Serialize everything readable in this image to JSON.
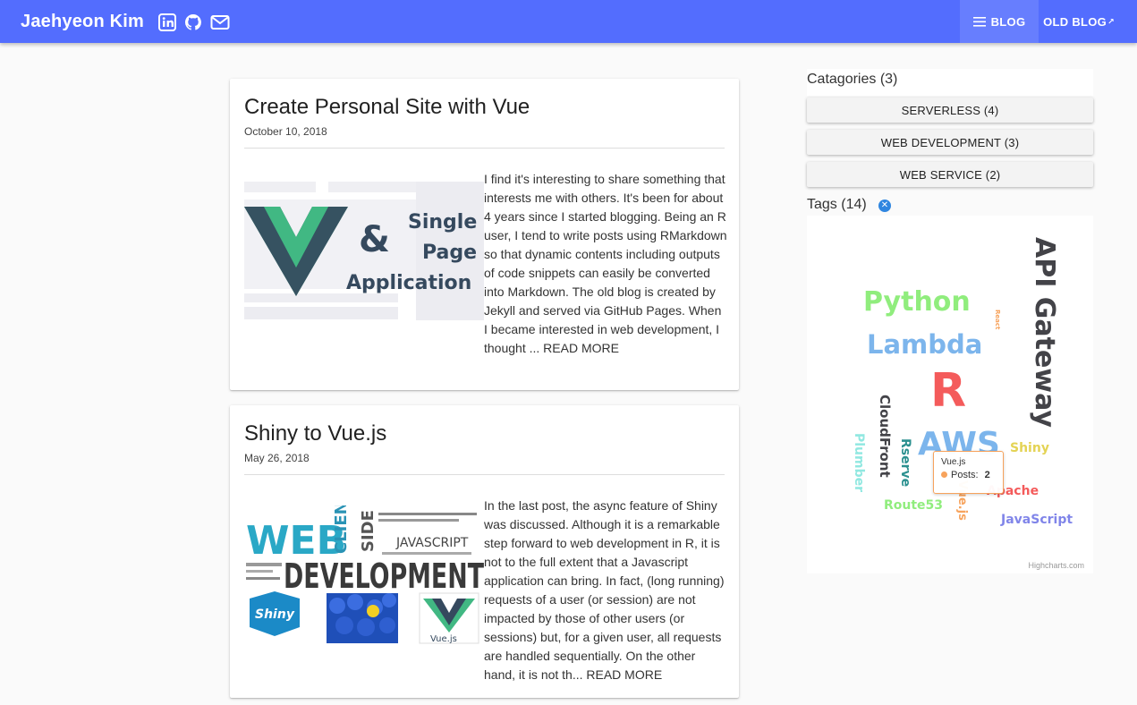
{
  "header": {
    "brand": "Jaehyeon Kim",
    "social_icons": [
      "linkedin-icon",
      "github-icon",
      "mail-icon"
    ],
    "nav": {
      "blog": "BLOG",
      "old_blog": "OLD BLOG"
    },
    "color": "#536dfe"
  },
  "posts": [
    {
      "title": "Create Personal Site with Vue",
      "date": "October 10, 2018",
      "image_text": {
        "line1": "Single",
        "line2": "Page",
        "line3": "Application",
        "amp": "&"
      },
      "excerpt": "I find it's interesting to share something that interests me with others. It's been for about 4 years since I started blogging. Being an R user, I tend to write posts using RMarkdown so that dynamic contents including outputs of code snippets can easily be converted into Markdown. The old blog is created by Jekyll and served via GitHub Pages. When I became interested in web development, I thought ... READ MORE"
    },
    {
      "title": "Shiny to Vue.js",
      "date": "May 26, 2018",
      "image_text": {
        "web": "WEB",
        "development": "DEVELOPMENT",
        "javascript": "JAVASCRIPT",
        "client": "CLIEN",
        "side": "SIDE",
        "shiny": "Shiny",
        "vue": "Vue.js"
      },
      "excerpt": "In the last post, the async feature of Shiny was discussed. Although it is a remarkable step forward to web development in R, it is not to the full extent that a Javascript application can bring. In fact, (long running) requests of a user (or session) are not impacted by those of other users (or sessions) but, for a given user, all requests are handled sequentially. On the other hand, it is not th... READ MORE"
    }
  ],
  "sidebar": {
    "categories_label": "Catagories (3)",
    "categories": [
      "SERVERLESS (4)",
      "WEB DEVELOPMENT (3)",
      "WEB SERVICE (2)"
    ],
    "tags_label": "Tags (14)",
    "clear_icon": "close-circle-icon",
    "wordcloud": {
      "words": [
        {
          "text": "API Gateway",
          "color": "#434348"
        },
        {
          "text": "Python",
          "color": "#90ed7d"
        },
        {
          "text": "Lambda",
          "color": "#7cb5ec"
        },
        {
          "text": "R",
          "color": "#f45b5b"
        },
        {
          "text": "AWS",
          "color": "#7cb5ec"
        },
        {
          "text": "CloudFront",
          "color": "#434348"
        },
        {
          "text": "Rserve",
          "color": "#2b908f"
        },
        {
          "text": "Plumber",
          "color": "#91e8e1"
        },
        {
          "text": "Shiny",
          "color": "#e4d354"
        },
        {
          "text": "Apache",
          "color": "#f45b5b"
        },
        {
          "text": "Route53",
          "color": "#90ed7d"
        },
        {
          "text": "Vue.js",
          "color": "#f7a35c"
        },
        {
          "text": "JavaScript",
          "color": "#8085e9"
        },
        {
          "text": "React",
          "color": "#f7a35c"
        }
      ],
      "credits": "Highcharts.com",
      "tooltip": {
        "name": "Vue.js",
        "label": "Posts:",
        "value": "2"
      }
    }
  }
}
